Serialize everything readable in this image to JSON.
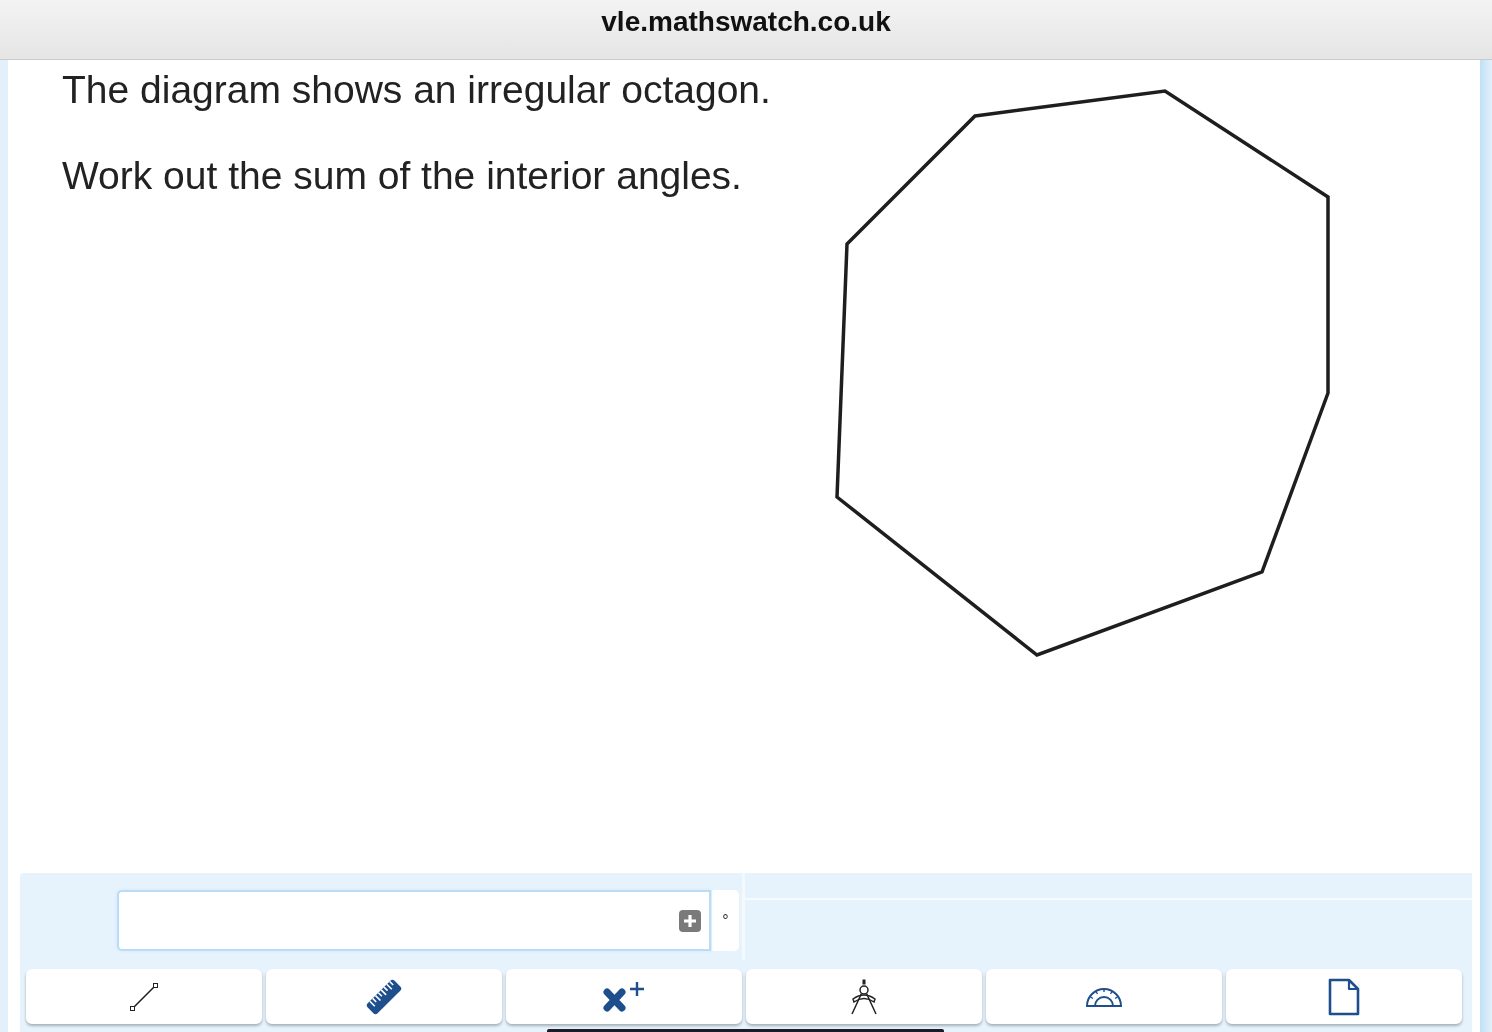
{
  "browser_bar": {
    "title": "vle.mathswatch.co.uk"
  },
  "question": {
    "lines": [
      "The diagram shows an irregular octagon.",
      "Work out the sum of the interior angles."
    ]
  },
  "answer": {
    "unit": "°"
  },
  "tools": [
    {
      "kind": "line"
    },
    {
      "kind": "ruler"
    },
    {
      "kind": "mark"
    },
    {
      "kind": "compass"
    },
    {
      "kind": "protractor"
    },
    {
      "kind": "page"
    }
  ]
}
